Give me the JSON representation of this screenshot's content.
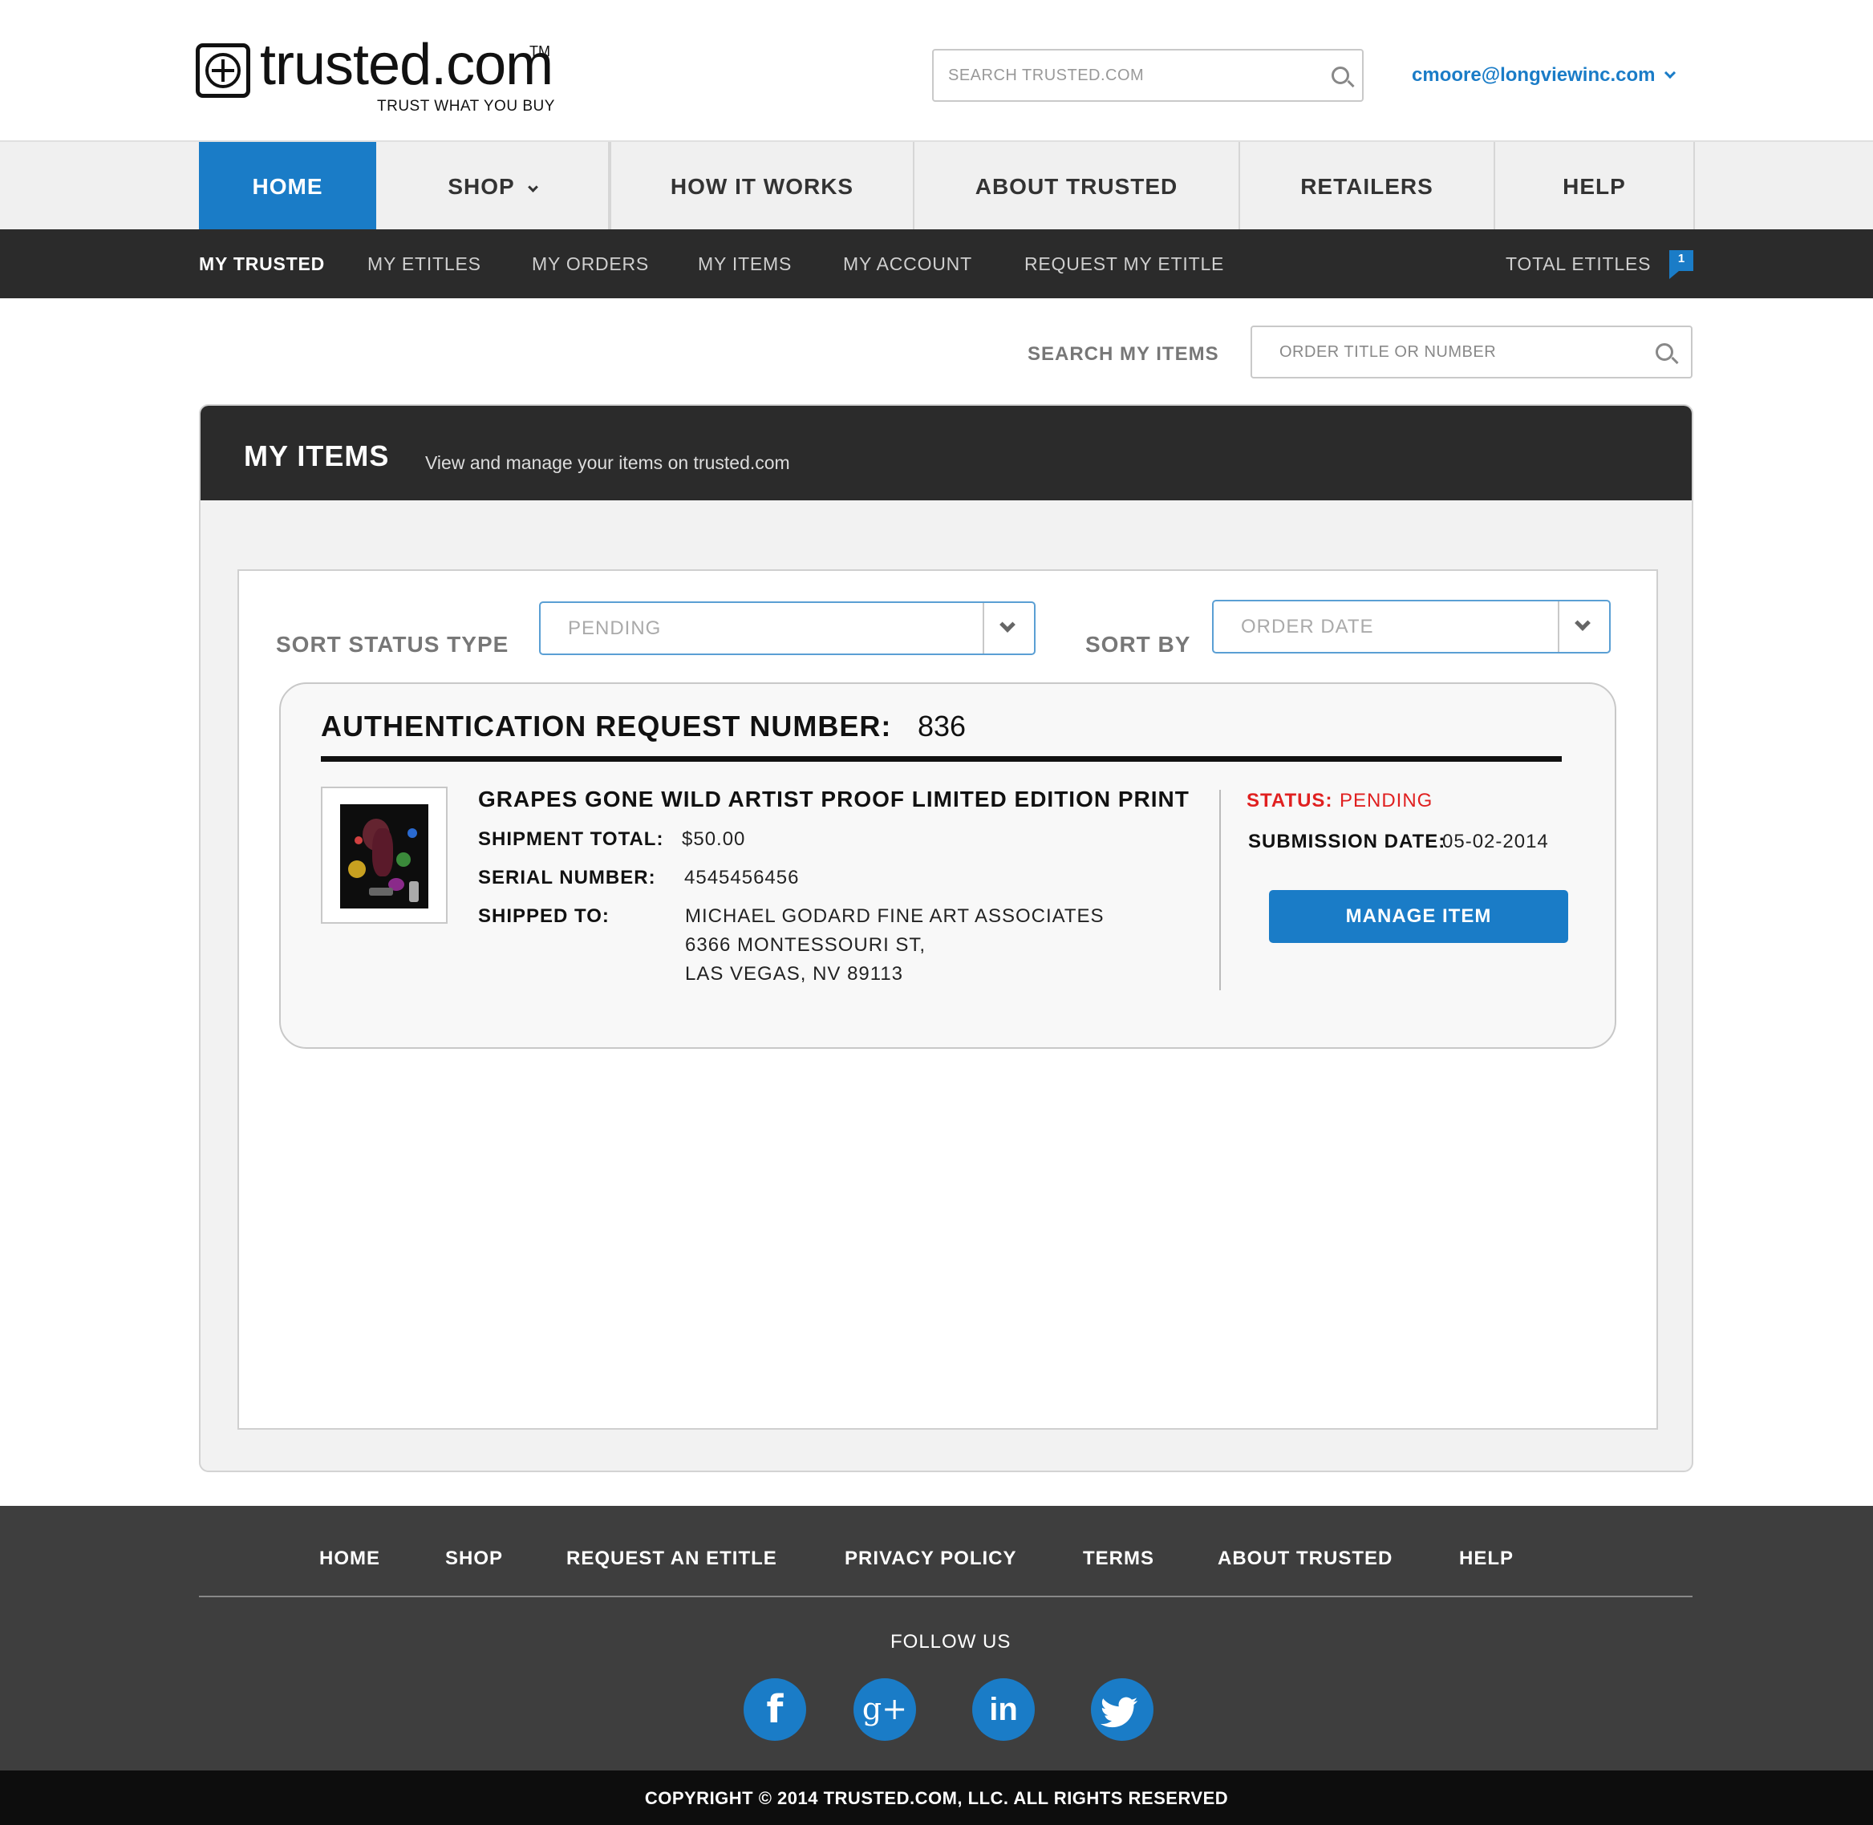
{
  "header": {
    "logo_word": "trusted.com",
    "logo_tm": "TM",
    "logo_tagline": "TRUST WHAT YOU BUY",
    "search_placeholder": "SEARCH TRUSTED.COM",
    "user_email": "cmoore@longviewinc.com"
  },
  "main_nav": {
    "items": [
      {
        "label": "HOME",
        "active": true
      },
      {
        "label": "SHOP",
        "has_dropdown": true
      },
      {
        "label": "HOW IT WORKS"
      },
      {
        "label": "ABOUT TRUSTED"
      },
      {
        "label": "RETAILERS"
      },
      {
        "label": "HELP"
      }
    ]
  },
  "sub_nav": {
    "items": [
      {
        "label": "MY TRUSTED"
      },
      {
        "label": "MY ETITLES"
      },
      {
        "label": "MY ORDERS"
      },
      {
        "label": "MY ITEMS"
      },
      {
        "label": "MY ACCOUNT"
      },
      {
        "label": "REQUEST MY ETITLE"
      }
    ],
    "total_etitles_label": "TOTAL ETITLES",
    "total_etitles_count": "1"
  },
  "items_search": {
    "label": "SEARCH MY ITEMS",
    "placeholder": "ORDER TITLE OR NUMBER"
  },
  "panel": {
    "title": "MY ITEMS",
    "subtitle": "View and manage your items on trusted.com",
    "sort_status_label": "SORT STATUS TYPE",
    "sort_status_value": "PENDING",
    "sort_by_label": "SORT BY",
    "sort_by_value": "ORDER DATE"
  },
  "request": {
    "label": "AUTHENTICATION REQUEST NUMBER:",
    "number": "836",
    "item_title": "GRAPES GONE WILD ARTIST PROOF LIMITED EDITION PRINT",
    "shipment_total_label": "SHIPMENT TOTAL:",
    "shipment_total": "$50.00",
    "serial_label": "SERIAL NUMBER:",
    "serial": "4545456456",
    "shipped_to_label": "SHIPPED TO:",
    "address_line1": "MICHAEL GODARD FINE ART ASSOCIATES",
    "address_line2": "6366 MONTESSOURI ST,",
    "address_line3": "LAS VEGAS, NV 89113",
    "status_label": "STATUS:",
    "status": "PENDING",
    "submission_label": "SUBMISSION DATE:",
    "submission_date": "05-02-2014",
    "manage_button": "MANAGE ITEM"
  },
  "footer": {
    "links": [
      "HOME",
      "SHOP",
      "REQUEST AN ETITLE",
      "PRIVACY POLICY",
      "TERMS",
      "ABOUT TRUSTED",
      "HELP"
    ],
    "follow_label": "FOLLOW US",
    "social": [
      {
        "icon": "facebook-icon",
        "glyph": "f"
      },
      {
        "icon": "google-plus-icon",
        "glyph": "g+"
      },
      {
        "icon": "linkedin-icon",
        "glyph": "in"
      },
      {
        "icon": "twitter-icon",
        "glyph": "t"
      }
    ],
    "copyright": "COPYRIGHT © 2014 TRUSTED.COM, LLC. ALL RIGHTS RESERVED"
  },
  "colors": {
    "accent": "#1a7cc7",
    "dark_bar": "#2b2b2b",
    "footer": "#3e3e3e",
    "status_pending": "#e02020"
  }
}
